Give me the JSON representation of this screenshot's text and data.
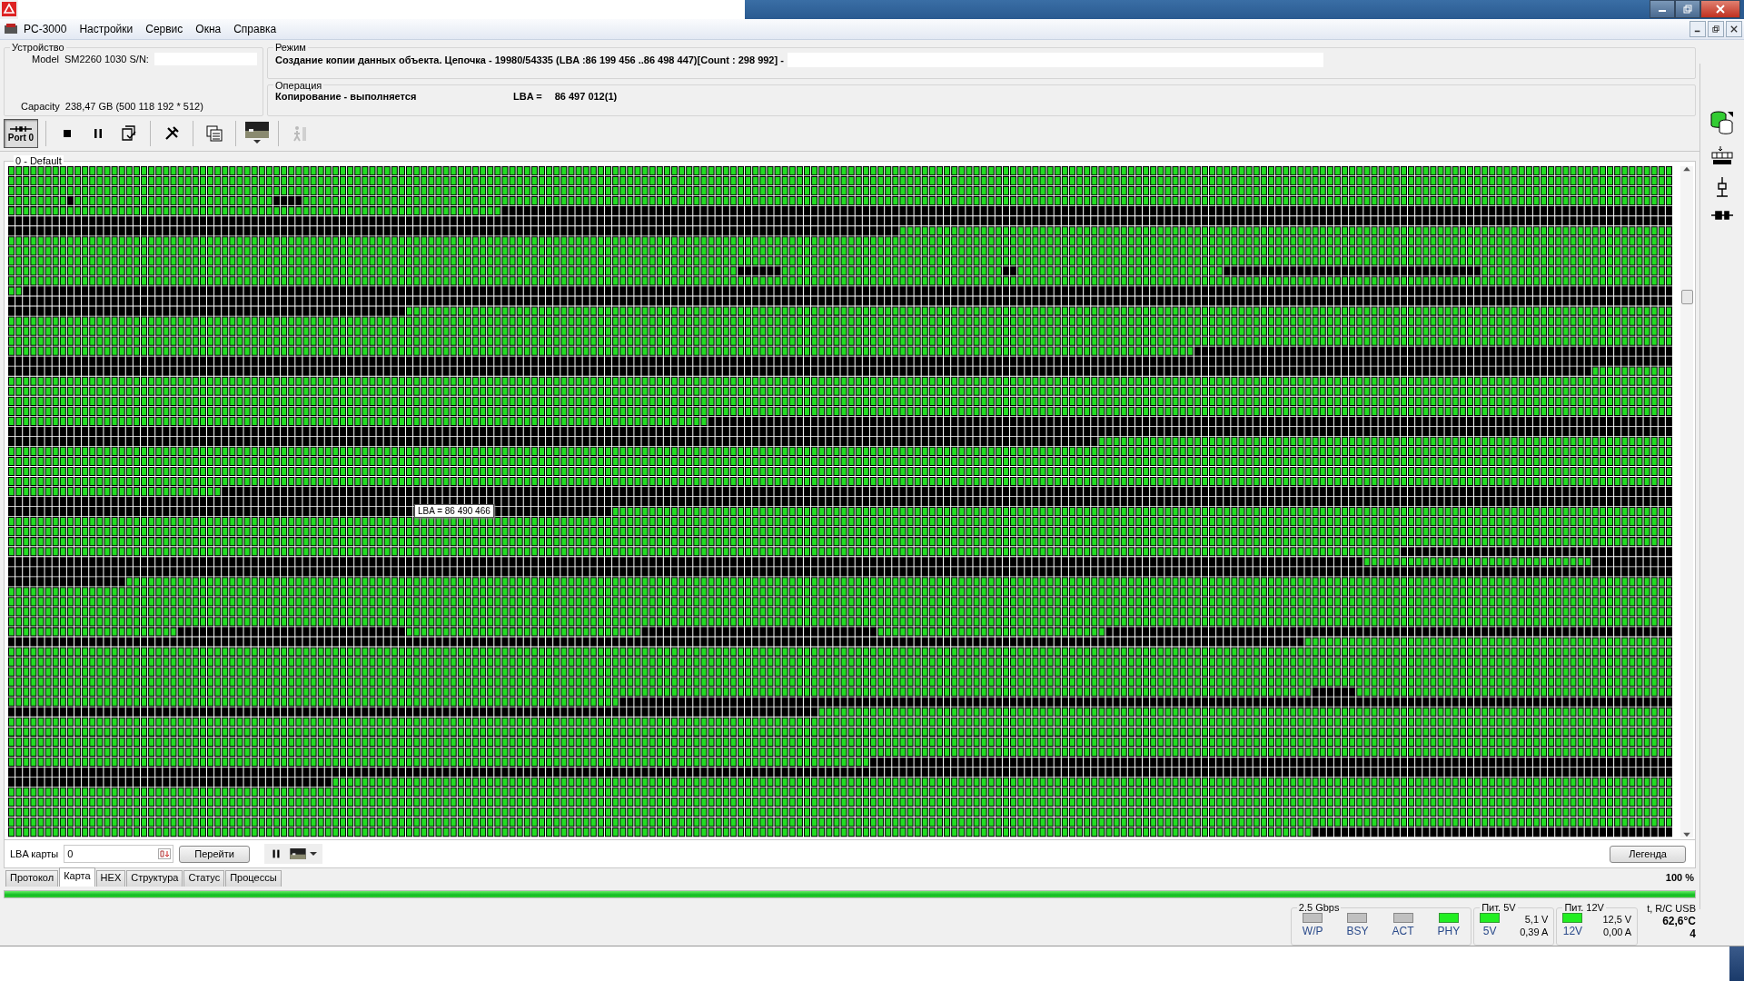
{
  "menu": [
    {
      "label": "PC-3000",
      "kind": "app"
    },
    {
      "label": "Настройки",
      "kind": "item"
    },
    {
      "label": "Сервис",
      "kind": "item"
    },
    {
      "label": "Окна",
      "kind": "item"
    },
    {
      "label": "Справка",
      "kind": "item"
    }
  ],
  "device": {
    "title": "Устройство",
    "model_label": "Model",
    "model": "SM2260 1030 S/N:",
    "capacity_label": "Capacity",
    "capacity": "238,47 GB (500 118 192 * 512)"
  },
  "mode": {
    "title": "Режим",
    "text": "Создание копии данных объекта. Цепочка - 19980/54335 (LBA :86 199 456 ..86 498 447)[Count :  298 992] -"
  },
  "operation": {
    "title": "Операция",
    "text": "Копирование - выполняется",
    "lba_label": "LBA =",
    "lba": "86 497 012(1)"
  },
  "toolbar": [
    {
      "kind": "port",
      "label": "Port 0",
      "pressed": true,
      "disabled": false
    },
    {
      "kind": "stop",
      "pressed": false,
      "disabled": false
    },
    {
      "kind": "pause",
      "pressed": false,
      "disabled": false
    },
    {
      "kind": "export",
      "pressed": false,
      "disabled": false
    },
    {
      "kind": "tools",
      "pressed": false,
      "disabled": false
    },
    {
      "kind": "copy",
      "pressed": false,
      "disabled": false
    },
    {
      "kind": "image",
      "pressed": false,
      "disabled": false
    },
    {
      "kind": "walk",
      "pressed": false,
      "disabled": true
    }
  ],
  "map": {
    "title": "0 - Default",
    "tooltip": "LBA =  86 490 466"
  },
  "map_controls": {
    "lba_label": "LBA карты",
    "lba_value": "0",
    "goto": "Перейти",
    "legend": "Легенда"
  },
  "tabs": [
    {
      "label": "Протокол",
      "selected": false
    },
    {
      "label": "Карта",
      "selected": true
    },
    {
      "label": "HEX",
      "selected": false
    },
    {
      "label": "Структура",
      "selected": false
    },
    {
      "label": "Статус",
      "selected": false
    },
    {
      "label": "Процессы",
      "selected": false
    }
  ],
  "progress": {
    "text": "100 %",
    "level": 1
  },
  "status": {
    "link": {
      "title": "2.5 Gbps",
      "leds": [
        {
          "label": "W/P",
          "on": false
        },
        {
          "label": "BSY",
          "on": false
        },
        {
          "label": "ACT",
          "on": false
        },
        {
          "label": "PHY",
          "on": true
        }
      ]
    },
    "power": [
      {
        "title": "Пит. 5V",
        "led_label": "5V",
        "on": true,
        "voltage": "5,1 V",
        "current": "0,39 A"
      },
      {
        "title": "Пит. 12V",
        "led_label": "12V",
        "on": true,
        "voltage": "12,5 V",
        "current": "0,00 A"
      }
    ],
    "temp": {
      "title": "t, R/C USB",
      "value": "62,6°C",
      "count": "4"
    }
  }
}
